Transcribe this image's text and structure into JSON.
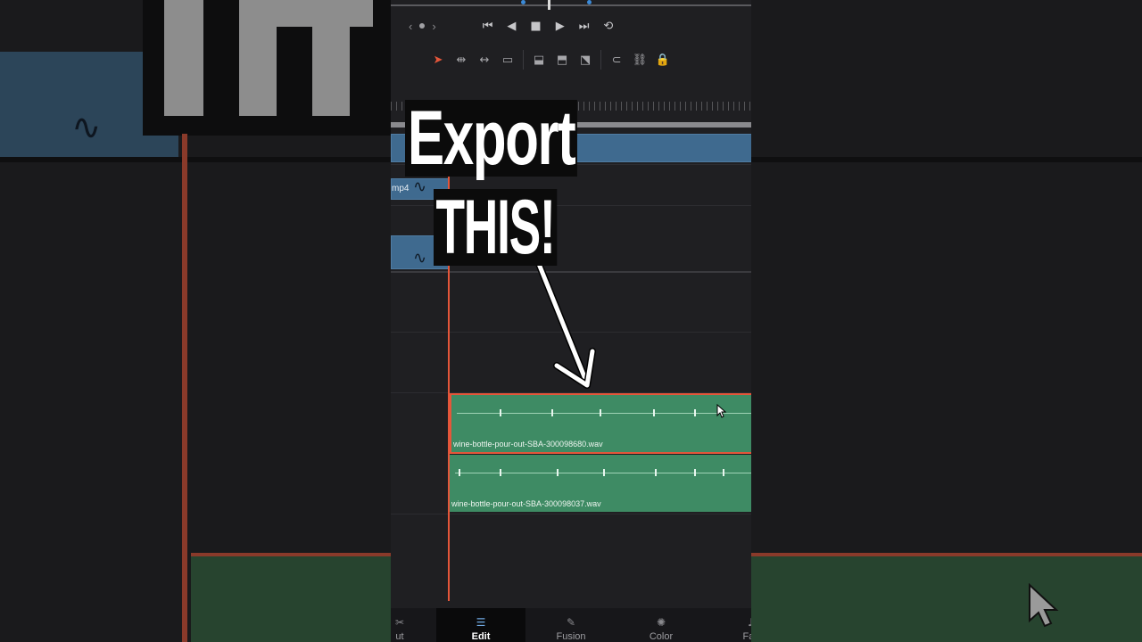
{
  "transport": {
    "nav_prev": "‹",
    "nav_next": "›",
    "controls": [
      {
        "name": "go-to-start-icon",
        "glyph": "⏮"
      },
      {
        "name": "reverse-play-icon",
        "glyph": "◀"
      },
      {
        "name": "stop-icon",
        "glyph": "■"
      },
      {
        "name": "play-icon",
        "glyph": "▶"
      },
      {
        "name": "go-to-end-icon",
        "glyph": "⏭"
      },
      {
        "name": "loop-icon",
        "glyph": "⟲"
      }
    ]
  },
  "toolbar": {
    "tools": [
      {
        "name": "selection-tool-icon",
        "glyph": "➤",
        "selected": true
      },
      {
        "name": "trim-tool-icon",
        "glyph": "⇹"
      },
      {
        "name": "dynamic-trim-icon",
        "glyph": "↔"
      },
      {
        "name": "blade-tool-icon",
        "glyph": "▭"
      },
      {
        "name": "insert-clip-icon",
        "glyph": "⬓"
      },
      {
        "name": "overwrite-clip-icon",
        "glyph": "⬒"
      },
      {
        "name": "replace-clip-icon",
        "glyph": "⬔"
      },
      {
        "name": "snapping-icon",
        "glyph": "⊂"
      },
      {
        "name": "link-icon",
        "glyph": "⛓"
      },
      {
        "name": "lock-icon",
        "glyph": "🔒"
      }
    ],
    "accent_color": "#e4563a"
  },
  "timeline": {
    "video_clip_label": "mp4",
    "audio_clips": [
      {
        "name": "wine-bottle-pour-out-SBA-300098680.wav",
        "selected": true
      },
      {
        "name": "wine-bottle-pour-out-SBA-300098037.wav",
        "selected": false
      }
    ],
    "clip_color": "#3e8b64",
    "video_color": "#3f6a8f"
  },
  "overlay": {
    "line1": "Export",
    "line2": "THIS!"
  },
  "pages": [
    {
      "label": "ut",
      "icon": "cut-icon",
      "active": false
    },
    {
      "label": "Edit",
      "icon": "edit-icon",
      "active": true
    },
    {
      "label": "Fusion",
      "icon": "fusion-icon",
      "active": false
    },
    {
      "label": "Color",
      "icon": "color-icon",
      "active": false
    },
    {
      "label": "Fair",
      "icon": "fairlight-icon",
      "active": false
    }
  ]
}
